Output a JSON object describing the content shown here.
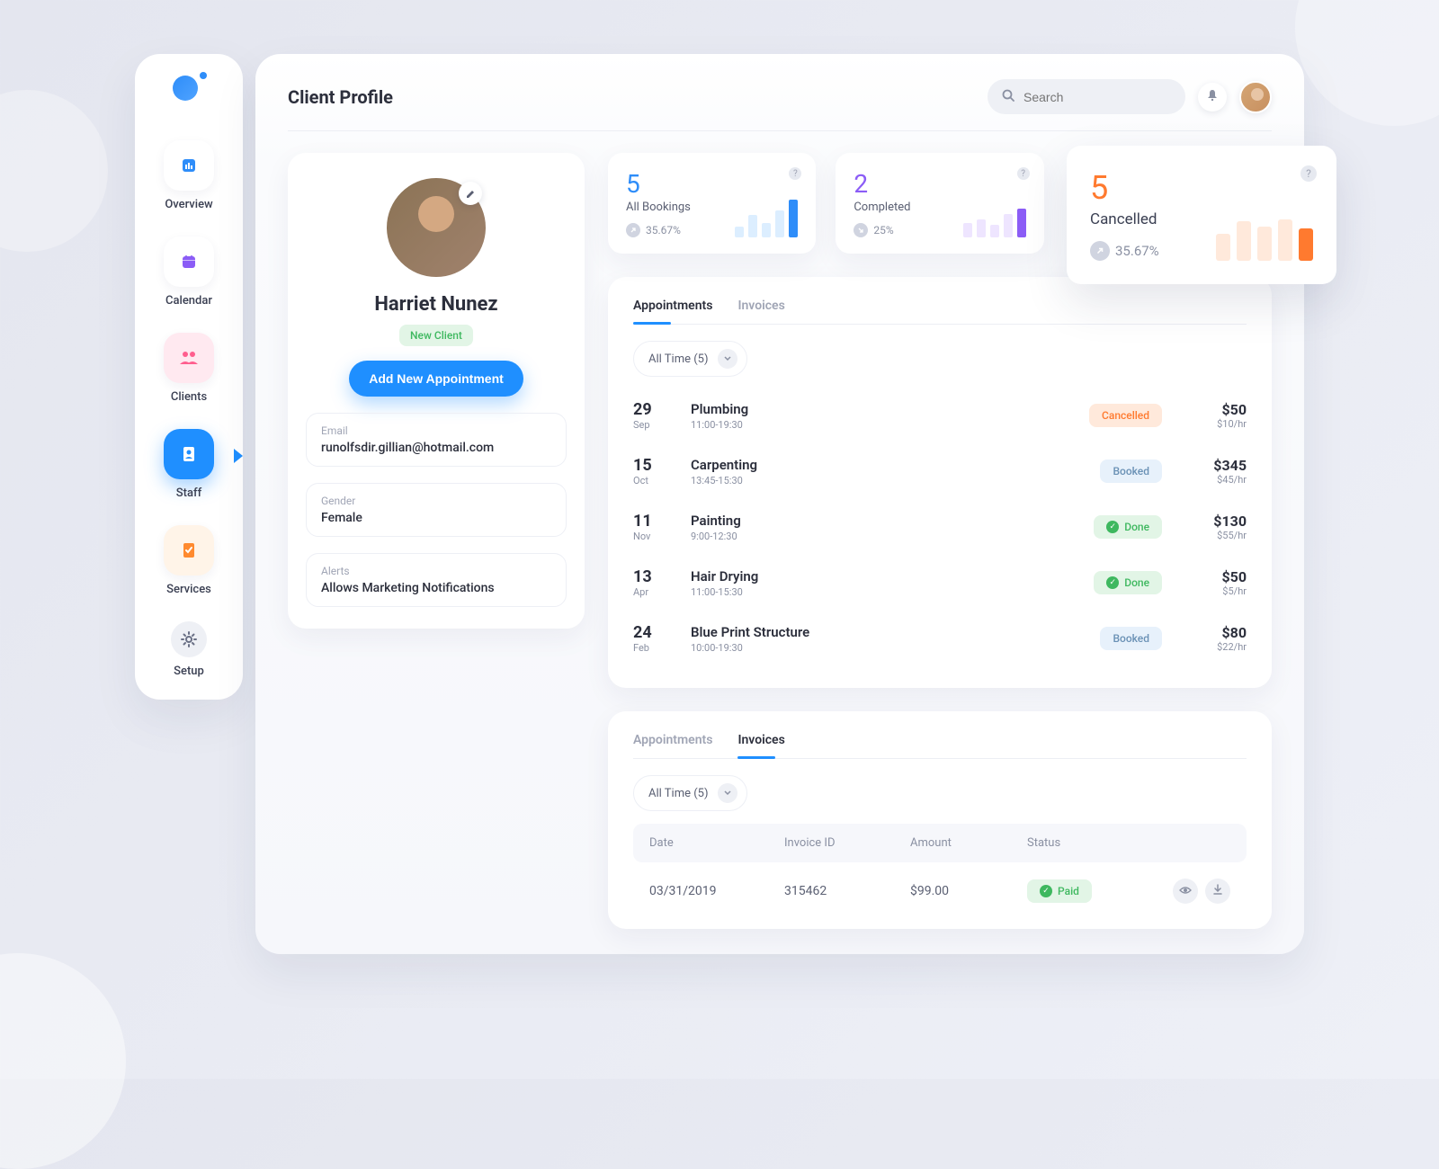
{
  "page_title": "Client Profile",
  "search_placeholder": "Search",
  "sidebar": {
    "items": [
      {
        "label": "Overview"
      },
      {
        "label": "Calendar"
      },
      {
        "label": "Clients"
      },
      {
        "label": "Staff"
      },
      {
        "label": "Services"
      },
      {
        "label": "Setup"
      }
    ]
  },
  "profile": {
    "name": "Harriet Nunez",
    "badge": "New Client",
    "add_btn": "Add New Appointment",
    "fields": [
      {
        "label": "Email",
        "value": "runolfsdir.gillian@hotmail.com"
      },
      {
        "label": "Gender",
        "value": "Female"
      },
      {
        "label": "Alerts",
        "value": "Allows Marketing Notifications"
      }
    ]
  },
  "stats": [
    {
      "num": "5",
      "label": "All Bookings",
      "pct": "35.67%",
      "color": "blue"
    },
    {
      "num": "2",
      "label": "Completed",
      "pct": "25%",
      "color": "purple"
    },
    {
      "num": "5",
      "label": "Cancelled",
      "pct": "35.67%",
      "color": "orange"
    }
  ],
  "chart_data": [
    {
      "type": "bar",
      "title": "All Bookings",
      "values": [
        12,
        25,
        16,
        30,
        42
      ],
      "color_light": "#dceeff",
      "color_dark": "#2e8df9"
    },
    {
      "type": "bar",
      "title": "Completed",
      "values": [
        16,
        20,
        14,
        26,
        32
      ],
      "color_light": "#eee5ff",
      "color_dark": "#8b5cf6"
    },
    {
      "type": "bar",
      "title": "Cancelled",
      "values": [
        30,
        44,
        38,
        46,
        36
      ],
      "color_light": "#ffe9db",
      "color_dark": "#ff7a2f"
    }
  ],
  "appointments": {
    "tabs": [
      "Appointments",
      "Invoices"
    ],
    "filter": "All Time (5)",
    "rows": [
      {
        "day": "29",
        "month": "Sep",
        "title": "Plumbing",
        "time": "11:00-19:30",
        "status": "Cancelled",
        "status_class": "cancelled",
        "price": "$50",
        "rate": "$10/hr"
      },
      {
        "day": "15",
        "month": "Oct",
        "title": "Carpenting",
        "time": "13:45-15:30",
        "status": "Booked",
        "status_class": "booked",
        "price": "$345",
        "rate": "$45/hr"
      },
      {
        "day": "11",
        "month": "Nov",
        "title": "Painting",
        "time": "9:00-12:30",
        "status": "Done",
        "status_class": "done",
        "price": "$130",
        "rate": "$55/hr"
      },
      {
        "day": "13",
        "month": "Apr",
        "title": "Hair Drying",
        "time": "11:00-15:30",
        "status": "Done",
        "status_class": "done",
        "price": "$50",
        "rate": "$5/hr"
      },
      {
        "day": "24",
        "month": "Feb",
        "title": "Blue Print Structure",
        "time": "10:00-19:30",
        "status": "Booked",
        "status_class": "booked",
        "price": "$80",
        "rate": "$22/hr"
      }
    ]
  },
  "invoices": {
    "tabs": [
      "Appointments",
      "Invoices"
    ],
    "filter": "All Time (5)",
    "columns": {
      "date": "Date",
      "id": "Invoice ID",
      "amount": "Amount",
      "status": "Status"
    },
    "rows": [
      {
        "date": "03/31/2019",
        "id": "315462",
        "amount": "$99.00",
        "status": "Paid"
      }
    ]
  }
}
